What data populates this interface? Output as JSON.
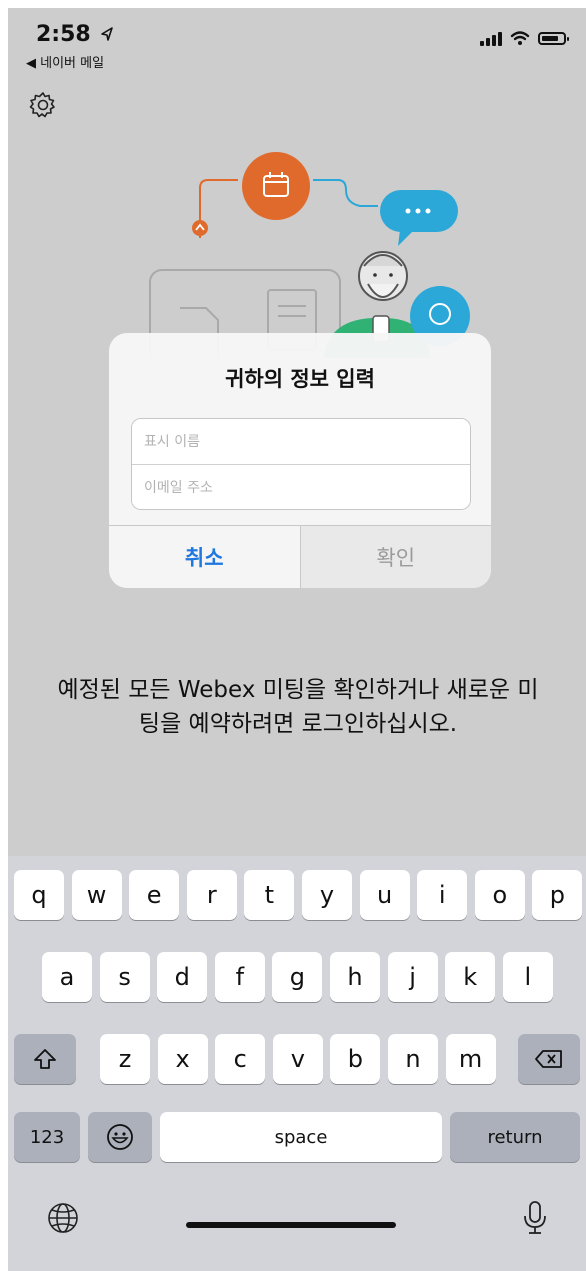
{
  "status": {
    "time": "2:58",
    "back_label": "◀ 네이버 메일"
  },
  "dialog": {
    "title": "귀하의 정보 입력",
    "display_name_placeholder": "표시 이름",
    "email_placeholder": "이메일 주소",
    "cancel_label": "취소",
    "confirm_label": "확인"
  },
  "message": "예정된 모든 Webex 미팅을 확인하거나 새로운 미팅을 예약하려면 로그인하십시오.",
  "keyboard": {
    "row1": [
      "q",
      "w",
      "e",
      "r",
      "t",
      "y",
      "u",
      "i",
      "o",
      "p"
    ],
    "row2": [
      "a",
      "s",
      "d",
      "f",
      "g",
      "h",
      "j",
      "k",
      "l"
    ],
    "row3": [
      "z",
      "x",
      "c",
      "v",
      "b",
      "n",
      "m"
    ],
    "numbers_label": "123",
    "space_label": "space",
    "return_label": "return"
  },
  "colors": {
    "accent": "#1f78e0",
    "illustration_orange": "#e06a2c",
    "illustration_blue": "#2ba8d8",
    "illustration_green": "#2fb273"
  }
}
